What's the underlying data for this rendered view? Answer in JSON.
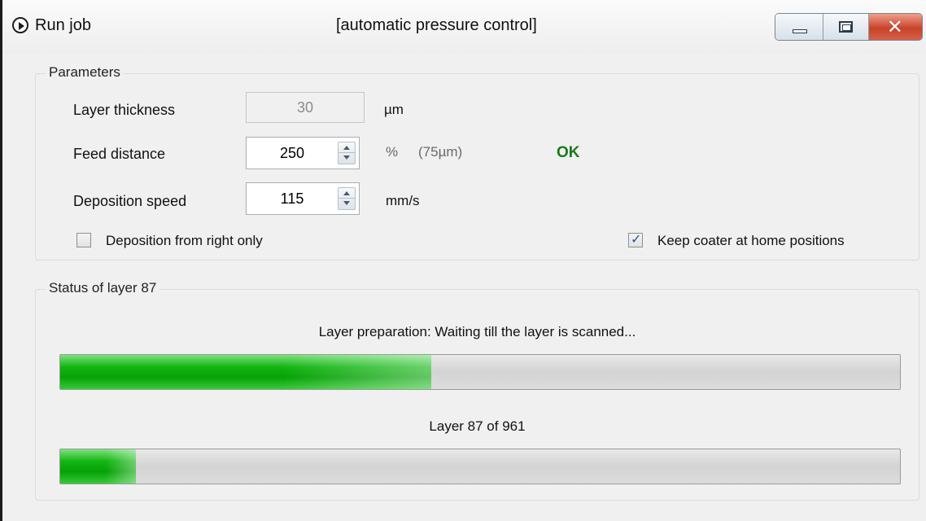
{
  "window": {
    "title": "Run job",
    "subtitle": "[automatic pressure control]",
    "icon": "play-circle-icon",
    "controls": [
      "minimize-icon",
      "maximize-icon",
      "close-icon"
    ],
    "close_color": "#c9432a"
  },
  "parameters": {
    "group_title": "Parameters",
    "layer_thickness": {
      "label": "Layer thickness",
      "value": "30",
      "unit": "µm",
      "disabled": true
    },
    "feed_distance": {
      "label": "Feed distance",
      "value": "250",
      "unit": "%",
      "hint": "(75µm)",
      "status": "OK",
      "status_color": "#1a7a1a"
    },
    "deposition_speed": {
      "label": "Deposition speed",
      "value": "115",
      "unit": "mm/s"
    },
    "deposition_right_only": {
      "label": "Deposition from right only",
      "checked": false
    },
    "keep_coater_home": {
      "label": "Keep coater at home positions",
      "checked": true
    }
  },
  "status": {
    "group_title": "Status of layer 87",
    "message": "Layer preparation: Waiting till the layer is scanned...",
    "layer_progress_fraction": 0.442,
    "layer_count_text": "Layer 87 of 961",
    "current_layer": 87,
    "total_layers": 961,
    "progress_color": "#13b513"
  }
}
